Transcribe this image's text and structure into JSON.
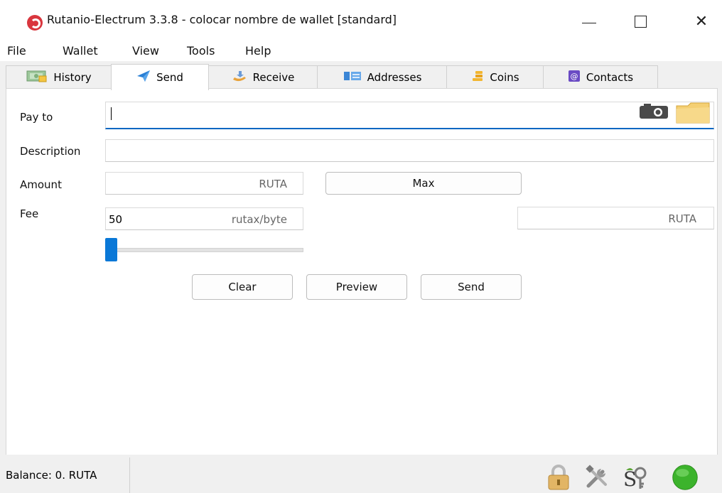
{
  "window": {
    "title": "Rutanio-Electrum 3.3.8  -  colocar nombre de wallet  [standard]",
    "minimize_icon": "minimize-icon",
    "maximize_icon": "maximize-icon",
    "close_glyph": "✕"
  },
  "menu": [
    "File",
    "Wallet",
    "View",
    "Tools",
    "Help"
  ],
  "tabs": [
    {
      "label": "History",
      "icon": "history-icon"
    },
    {
      "label": "Send",
      "icon": "send-icon",
      "active": true
    },
    {
      "label": "Receive",
      "icon": "receive-icon"
    },
    {
      "label": "Addresses",
      "icon": "addresses-icon"
    },
    {
      "label": "Coins",
      "icon": "coins-icon"
    },
    {
      "label": "Contacts",
      "icon": "contacts-icon"
    }
  ],
  "form": {
    "pay_to_label": "Pay to",
    "pay_to_value": "",
    "description_label": "Description",
    "description_value": "",
    "amount_label": "Amount",
    "amount_unit": "RUTA",
    "max_button": "Max",
    "fee_label": "Fee",
    "fee_value": "50",
    "fee_rate_unit": "rutax/byte",
    "fee_amount_unit": "RUTA",
    "fee_slider_level": 0
  },
  "buttons": {
    "clear": "Clear",
    "preview": "Preview",
    "send": "Send"
  },
  "status": {
    "balance": "Balance: 0. RUTA",
    "icons": [
      "lock-icon",
      "preferences-icon",
      "seed-icon",
      "network-status-icon"
    ]
  },
  "colors": {
    "accent": "#0a78d7",
    "status_connected": "#3cb32c",
    "logo_red": "#d9363e"
  }
}
